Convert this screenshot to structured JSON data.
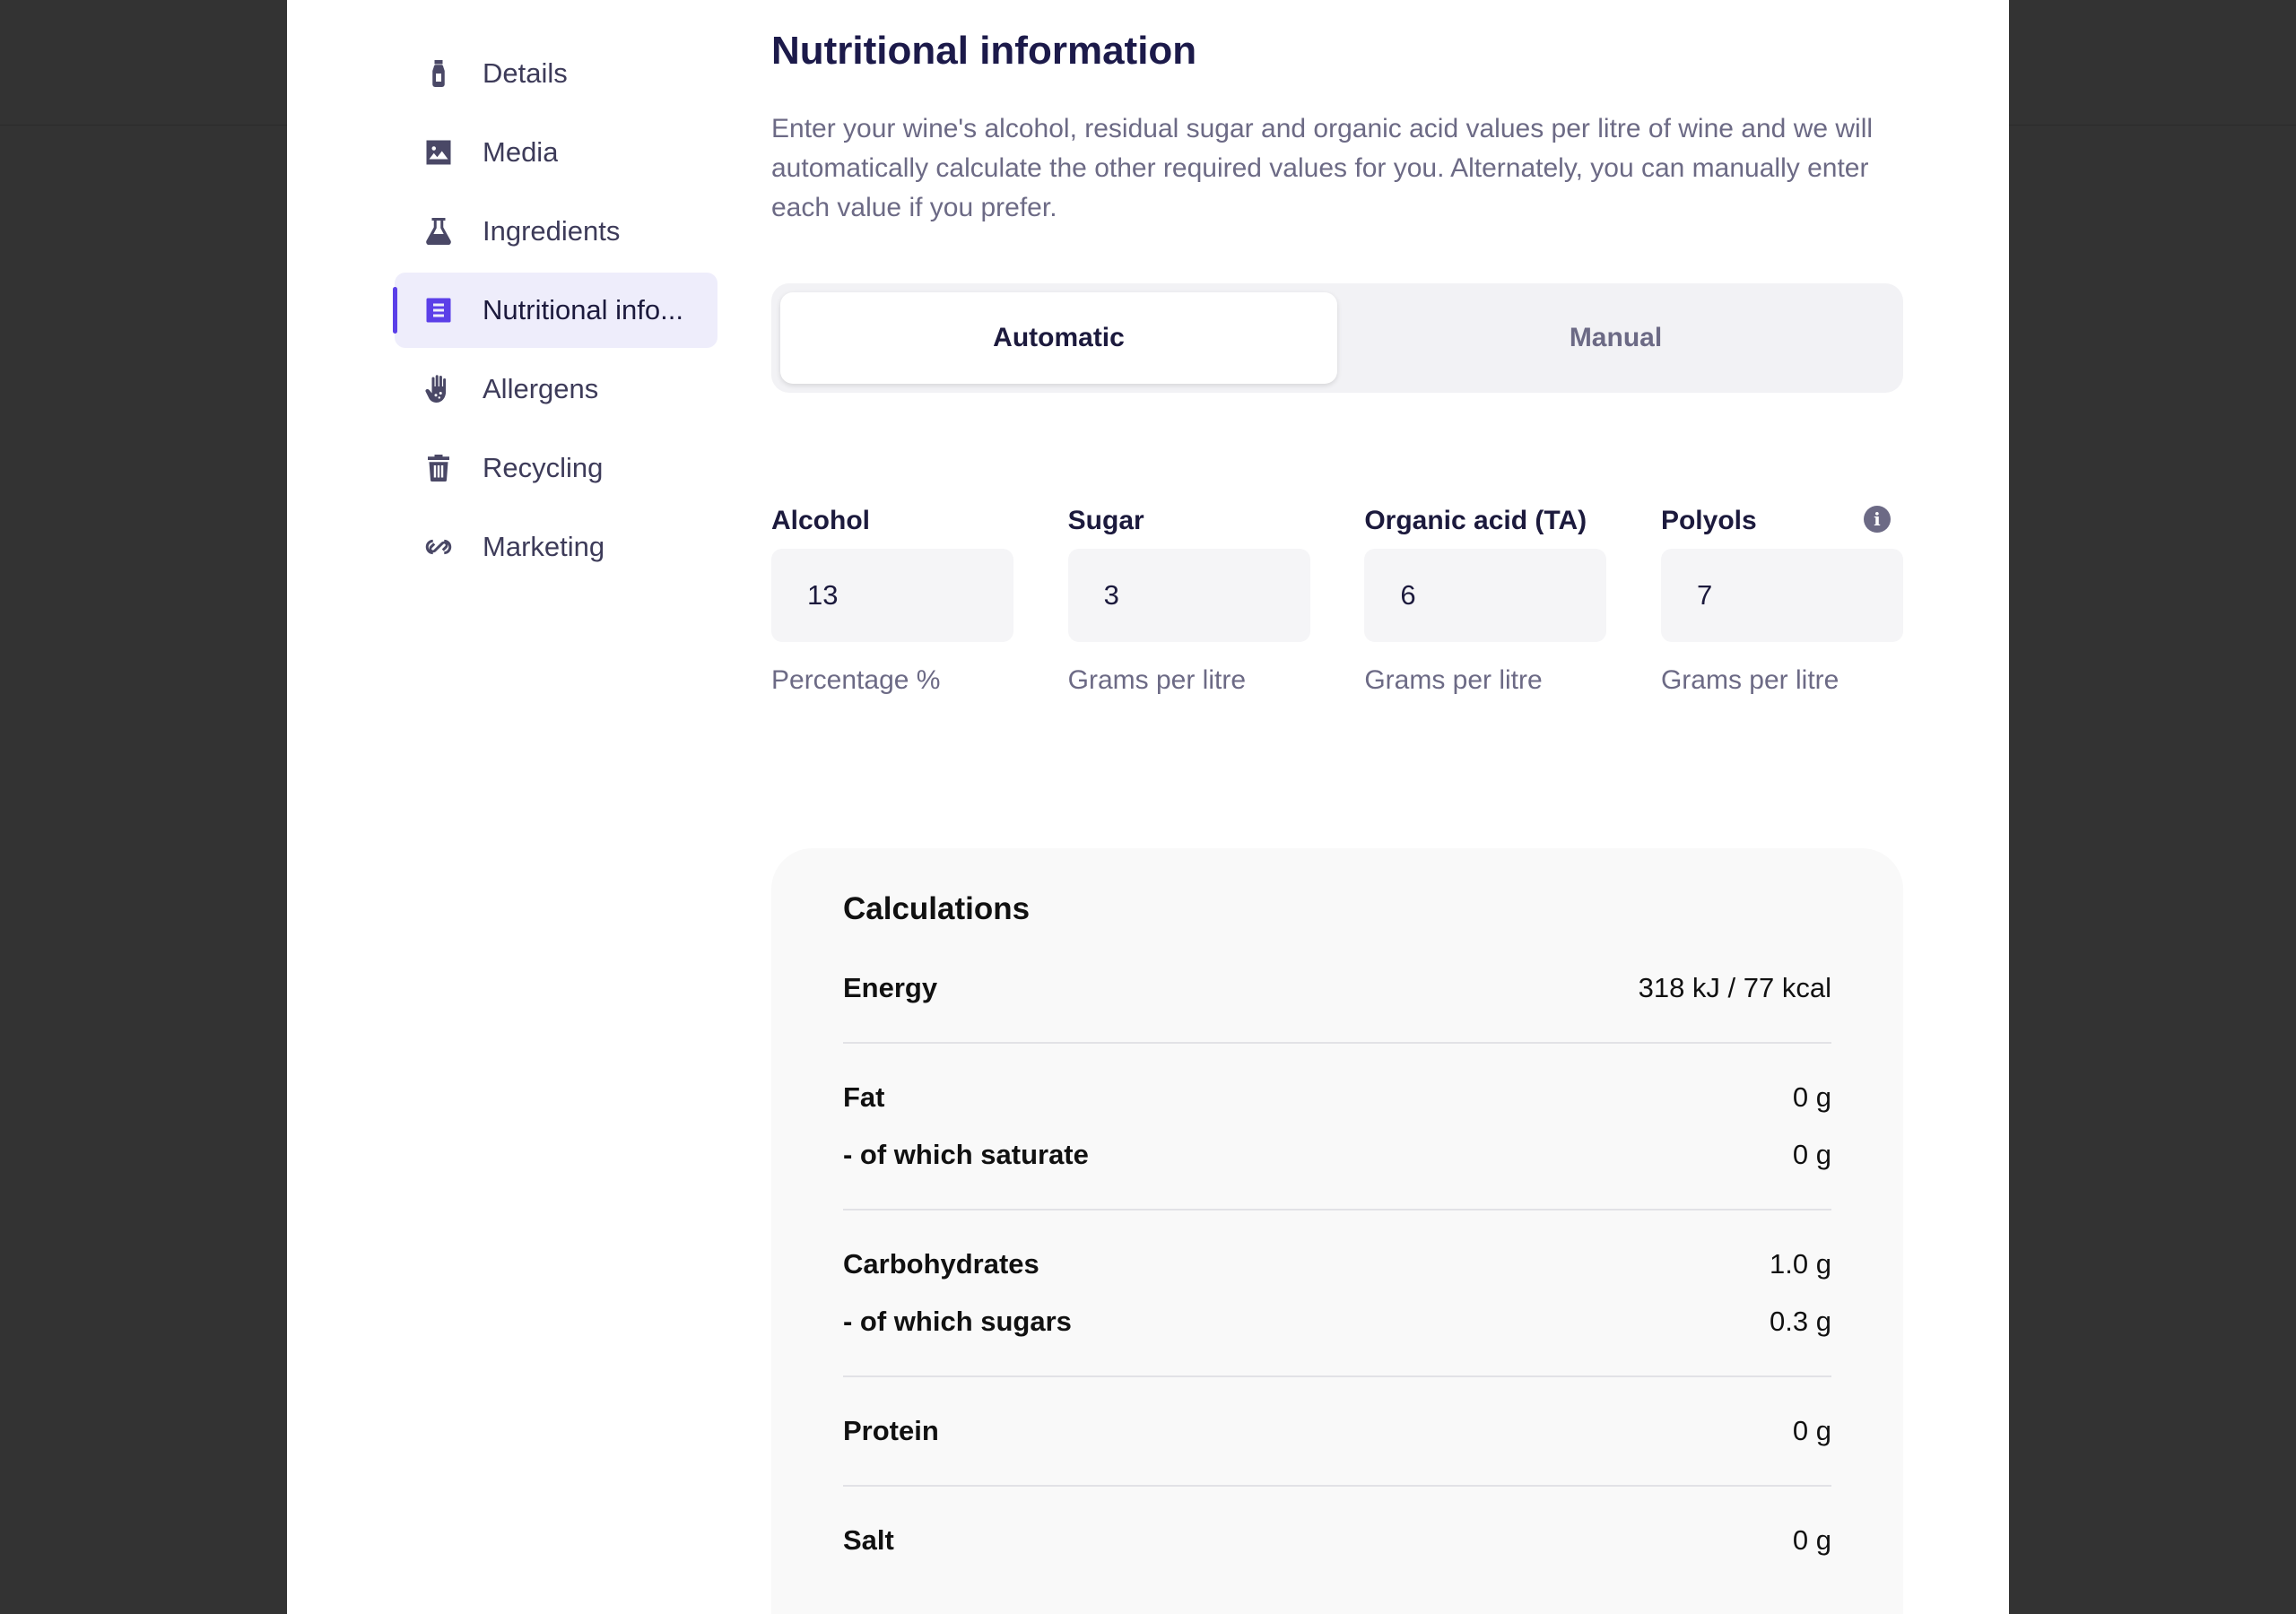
{
  "sidebar": {
    "items": [
      {
        "label": "Details",
        "icon": "bottle-icon"
      },
      {
        "label": "Media",
        "icon": "image-icon"
      },
      {
        "label": "Ingredients",
        "icon": "flask-icon"
      },
      {
        "label": "Nutritional info...",
        "icon": "list-icon"
      },
      {
        "label": "Allergens",
        "icon": "hand-icon"
      },
      {
        "label": "Recycling",
        "icon": "trash-icon"
      },
      {
        "label": "Marketing",
        "icon": "link-icon"
      }
    ],
    "active_index": 3,
    "accent_color": "#5b3fe8"
  },
  "main": {
    "title": "Nutritional information",
    "intro": "Enter your wine's alcohol, residual sugar and organic acid values per litre of wine and we will automatically calculate the other required values for you. Alternately, you can manually enter each value if you prefer.",
    "mode": {
      "options": [
        "Automatic",
        "Manual"
      ],
      "selected": "Automatic"
    },
    "fields": [
      {
        "label": "Alcohol",
        "value": "13",
        "unit": "Percentage %"
      },
      {
        "label": "Sugar",
        "value": "3",
        "unit": "Grams per litre"
      },
      {
        "label": "Organic acid (TA)",
        "value": "6",
        "unit": "Grams per litre"
      },
      {
        "label": "Polyols",
        "value": "7",
        "unit": "Grams per litre",
        "has_info": true
      }
    ],
    "calculations": {
      "title": "Calculations",
      "groups": [
        [
          {
            "name": "Energy",
            "value": "318 kJ / 77 kcal"
          }
        ],
        [
          {
            "name": "Fat",
            "value": "0 g"
          },
          {
            "name": "- of which saturate",
            "value": "0 g"
          }
        ],
        [
          {
            "name": "Carbohydrates",
            "value": "1.0 g"
          },
          {
            "name": "- of which sugars",
            "value": "0.3 g"
          }
        ],
        [
          {
            "name": "Protein",
            "value": "0 g"
          }
        ],
        [
          {
            "name": "Salt",
            "value": "0 g"
          }
        ]
      ]
    }
  }
}
